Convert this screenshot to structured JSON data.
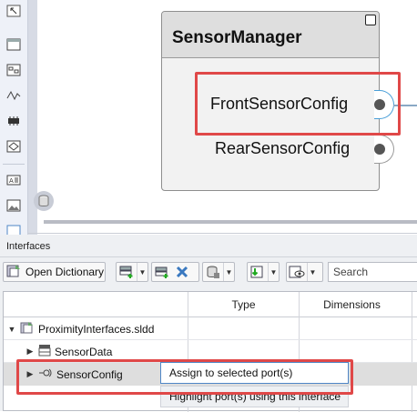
{
  "component": {
    "title": "SensorManager",
    "ports": [
      {
        "label": "FrontSensorConfig",
        "selected": true
      },
      {
        "label": "RearSensorConfig",
        "selected": false
      }
    ]
  },
  "palette": {
    "icons": [
      "zoom-fit-icon",
      "component-icon",
      "subsystem-icon",
      "signal-icon",
      "bus-icon",
      "variant-icon",
      "annotation-icon",
      "image-icon"
    ]
  },
  "interfaces_panel": {
    "title": "Interfaces",
    "toolbar": {
      "open_dictionary_label": "Open Dictionary",
      "search_placeholder": "Search"
    },
    "table": {
      "columns": [
        "",
        "Type",
        "Dimensions"
      ],
      "rows": [
        {
          "label": "ProximityInterfaces.sldd",
          "expanded": true,
          "icon": "dictionary-icon"
        },
        {
          "label": "SensorData",
          "expanded": false,
          "icon": "bus-element-icon"
        },
        {
          "label": "SensorConfig",
          "expanded": false,
          "icon": "interface-icon",
          "selected": true
        }
      ]
    },
    "context_menu": {
      "items": [
        "Assign to selected port(s)",
        "Highlight port(s) using this interface"
      ]
    }
  },
  "colors": {
    "highlight_red": "#e04848",
    "selected_port_blue": "#4a9fd8",
    "menu_focus_blue": "#4f86c6"
  }
}
